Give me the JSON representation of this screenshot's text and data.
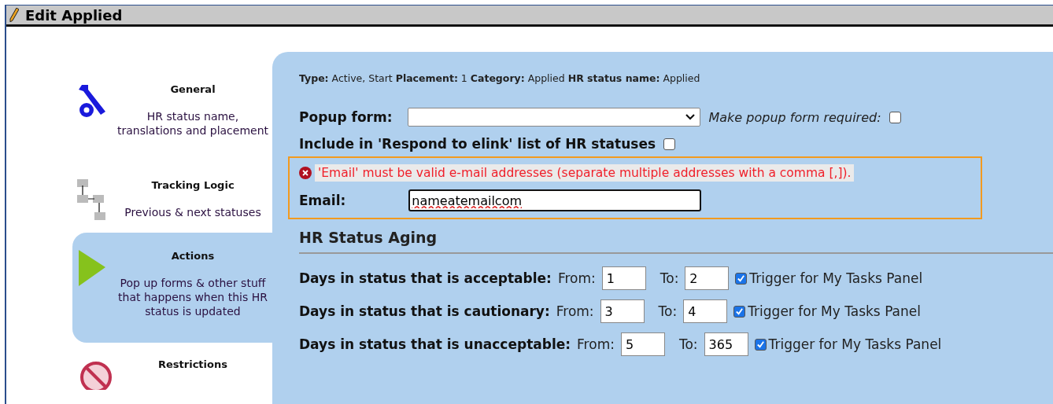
{
  "window": {
    "title": "Edit Applied"
  },
  "sidebar": {
    "items": [
      {
        "kind": "wrench",
        "title": "General",
        "description": "HR status name, translations and placement",
        "selected": false
      },
      {
        "kind": "flow",
        "title": "Tracking Logic",
        "description": "Previous & next statuses",
        "selected": false
      },
      {
        "kind": "play",
        "title": "Actions",
        "description": "Pop up forms & other stuff that happens when this HR status is updated",
        "selected": true
      },
      {
        "kind": "forbidden",
        "title": "Restrictions",
        "selected": false
      }
    ]
  },
  "meta": "**Type:** Active, Start **Placement:** 1 **Category:** Applied **HR status name:** Applied",
  "popup_form": {
    "label": "Popup form:",
    "required_label": "Make popup form required:",
    "required": false
  },
  "elink": {
    "label": "Include in 'Respond to elink' list of HR statuses",
    "checked": false
  },
  "error": {
    "message": "'Email' must be valid e-mail addresses (separate multiple addresses with a comma [,])."
  },
  "email": {
    "label": "Email:",
    "value": "nameatemailcom"
  },
  "aging": {
    "heading": "HR Status Aging",
    "rows": [
      {
        "label": "Days in status that is acceptable:",
        "from_label": "From:",
        "from": "1",
        "to_label": "To:",
        "to": "2",
        "trigger_label": "Trigger for My Tasks Panel",
        "trigger": true
      },
      {
        "label": "Days in status that is cautionary:",
        "from_label": "From:",
        "from": "3",
        "to_label": "To:",
        "to": "4",
        "trigger_label": "Trigger for My Tasks Panel",
        "trigger": true
      },
      {
        "label": "Days in status that is unacceptable:",
        "from_label": "From:",
        "from": "5",
        "to_label": "To:",
        "to": "365",
        "trigger_label": "Trigger for My Tasks Panel",
        "trigger": true
      }
    ]
  }
}
